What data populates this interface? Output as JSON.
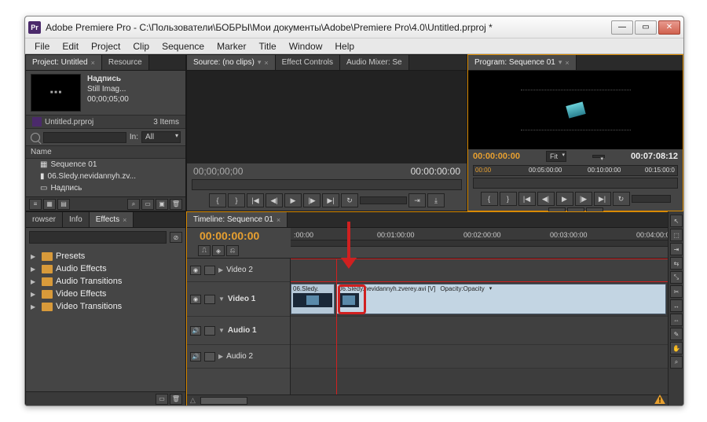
{
  "window": {
    "title": "Adobe Premiere Pro - C:\\Пользователи\\БОБРЫ\\Мои документы\\Adobe\\Premiere Pro\\4.0\\Untitled.prproj *",
    "app_icon_letter": "Pr"
  },
  "menus": [
    "File",
    "Edit",
    "Project",
    "Clip",
    "Sequence",
    "Marker",
    "Title",
    "Window",
    "Help"
  ],
  "project": {
    "tabs": [
      "Project: Untitled",
      "Resource"
    ],
    "preview_name": "Надпись",
    "preview_type": "Still Imag...",
    "preview_duration": "00;00;05;00",
    "file_label": "Untitled.prproj",
    "item_count": "3 Items",
    "filter_in": "In:",
    "filter_all": "All",
    "col_name": "Name",
    "items": [
      "Sequence 01",
      "06.Sledy.nevidannyh.zv...",
      "Надпись"
    ]
  },
  "source": {
    "tabs": [
      "Source: (no clips)",
      "Effect Controls",
      "Audio Mixer: Se"
    ],
    "tc_left": "00;00;00;00",
    "tc_right": "00:00:00:00"
  },
  "program": {
    "tab": "Program: Sequence 01",
    "tc_left": "00:00:00:00",
    "fit": "Fit",
    "tc_right": "00:07:08:12",
    "ruler_marks": [
      "00:00",
      "00:05:00:00",
      "00:10:00:00",
      "00:15:00:0"
    ]
  },
  "effects": {
    "tabs": [
      "rowser",
      "Info",
      "Effects"
    ],
    "nodes": [
      "Presets",
      "Audio Effects",
      "Audio Transitions",
      "Video Effects",
      "Video Transitions"
    ]
  },
  "timeline": {
    "tab": "Timeline: Sequence 01",
    "tc": "00:00:00:00",
    "ruler": [
      ":00:00",
      "00:01:00:00",
      "00:02:00:00",
      "00:03:00:00",
      "00:04:00:0"
    ],
    "tracks": {
      "video2": "Video 2",
      "video1": "Video 1",
      "audio1": "Audio 1",
      "audio2": "Audio 2"
    },
    "clip1_label": "06.Sledy.",
    "clip2_label": "06.Sledy.nevidannyh.zverey.avi [V]",
    "clip2_opacity": "Opacity:Opacity"
  }
}
